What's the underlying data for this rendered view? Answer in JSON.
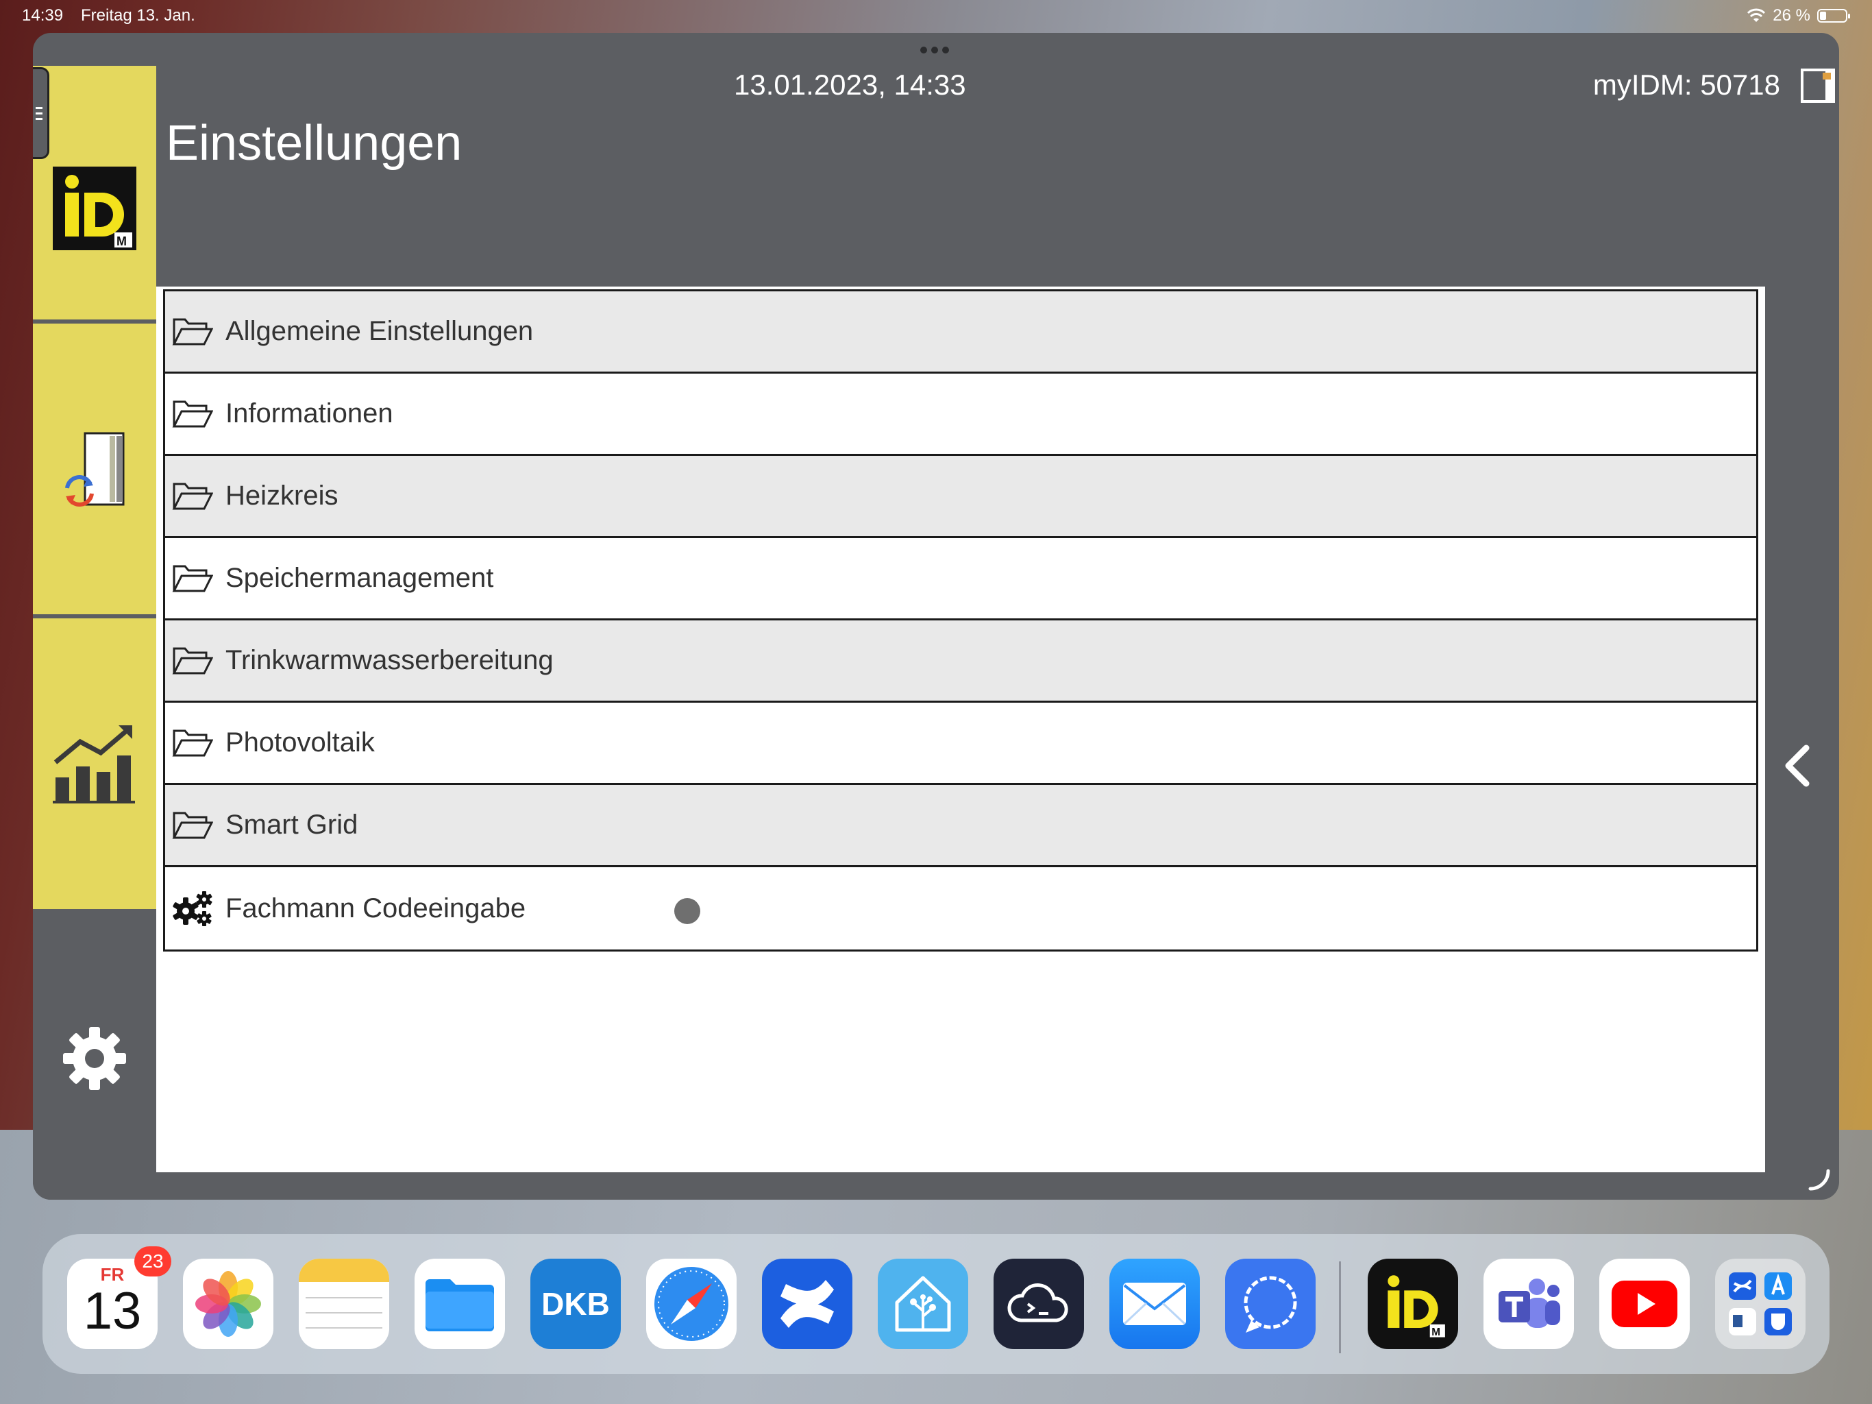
{
  "status_bar": {
    "time": "14:39",
    "date": "Freitag 13. Jan.",
    "battery": "26 %"
  },
  "header": {
    "datetime": "13.01.2023, 14:33",
    "device": "myIDM: 50718",
    "title": "Einstellungen"
  },
  "logo_text": "iDM",
  "menu": [
    {
      "label": "Allgemeine Einstellungen",
      "icon": "folder-icon"
    },
    {
      "label": "Informationen",
      "icon": "folder-icon"
    },
    {
      "label": "Heizkreis",
      "icon": "folder-icon"
    },
    {
      "label": "Speichermanagement",
      "icon": "folder-icon"
    },
    {
      "label": "Trinkwarmwasserbereitung",
      "icon": "folder-icon"
    },
    {
      "label": "Photovoltaik",
      "icon": "folder-icon"
    },
    {
      "label": "Smart Grid",
      "icon": "folder-icon"
    },
    {
      "label": "Fachmann Codeeingabe",
      "icon": "gears-icon"
    }
  ],
  "dock": {
    "calendar_day": "FR",
    "calendar_date": "13",
    "calendar_badge": "23",
    "dkb_label": "DKB"
  },
  "colors": {
    "sidebar_yellow": "#e4d85e",
    "window_gray": "#5c5e62",
    "row_gray": "#e9e9e9"
  }
}
